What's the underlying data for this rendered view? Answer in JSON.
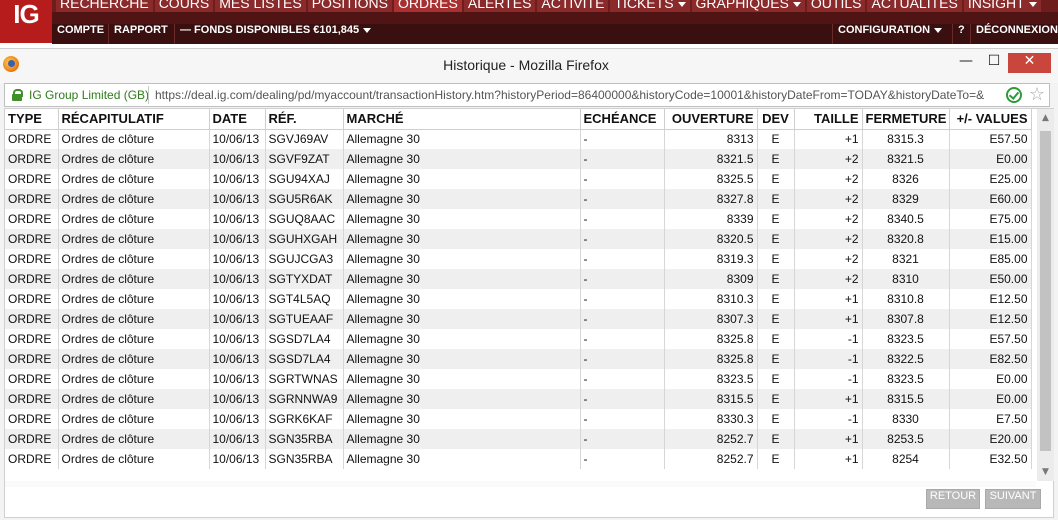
{
  "ig": {
    "logo": "IG",
    "nav": [
      {
        "label": "RECHERCHE",
        "caret": false
      },
      {
        "label": "COURS",
        "caret": false
      },
      {
        "label": "MES LISTES",
        "caret": false
      },
      {
        "label": "POSITIONS",
        "caret": false
      },
      {
        "label": "ORDRES",
        "caret": false,
        "active": true
      },
      {
        "label": "ALERTES",
        "caret": false
      },
      {
        "label": "ACTIVITÉ",
        "caret": false
      },
      {
        "label": "TICKETS",
        "caret": true
      },
      {
        "label": "GRAPHIQUES",
        "caret": true
      },
      {
        "label": "OUTILS",
        "caret": false
      },
      {
        "label": "ACTUALITÉS",
        "caret": false
      },
      {
        "label": "INSIGHT",
        "caret": true
      }
    ],
    "subnav": {
      "compte": "COMPTE",
      "rapport": "RAPPORT",
      "fonds": "— FONDS DISPONIBLES €101,845",
      "configuration": "CONFIGURATION",
      "help": "?",
      "deconnexion": "DÉCONNEXION"
    }
  },
  "window": {
    "title": "Historique - Mozilla Firefox",
    "minimize": "—",
    "maximize": "☐",
    "close": "✕"
  },
  "urlbar": {
    "site_identity": "IG Group Limited (GB)",
    "url": "https://deal.ig.com/dealing/pd/myaccount/transactionHistory.htm?historyPeriod=86400000&historyCode=10001&historyDateFrom=TODAY&historyDateTo=&"
  },
  "table": {
    "columns": [
      {
        "key": "type",
        "label": "TYPE",
        "align": "left"
      },
      {
        "key": "recap",
        "label": "RÉCAPITULATIF",
        "align": "left"
      },
      {
        "key": "date",
        "label": "DATE",
        "align": "left"
      },
      {
        "key": "ref",
        "label": "RÉF.",
        "align": "left"
      },
      {
        "key": "marche",
        "label": "MARCHÉ",
        "align": "left"
      },
      {
        "key": "echeance",
        "label": "ECHÉANCE",
        "align": "left"
      },
      {
        "key": "ouverture",
        "label": "OUVERTURE",
        "align": "right"
      },
      {
        "key": "dev",
        "label": "DEV",
        "align": "center"
      },
      {
        "key": "taille",
        "label": "TAILLE",
        "align": "right"
      },
      {
        "key": "fermeture",
        "label": "FERMETURE",
        "align": "center"
      },
      {
        "key": "values",
        "label": "+/- VALUES",
        "align": "right"
      }
    ],
    "rows": [
      {
        "type": "ORDRE",
        "recap": "Ordres de clôture",
        "date": "10/06/13",
        "ref": "SGVJ69AV",
        "marche": "Allemagne 30",
        "echeance": "-",
        "ouverture": "8313",
        "dev": "E",
        "taille": "+1",
        "fermeture": "8315.3",
        "values": "E57.50"
      },
      {
        "type": "ORDRE",
        "recap": "Ordres de clôture",
        "date": "10/06/13",
        "ref": "SGVF9ZAT",
        "marche": "Allemagne 30",
        "echeance": "-",
        "ouverture": "8321.5",
        "dev": "E",
        "taille": "+2",
        "fermeture": "8321.5",
        "values": "E0.00"
      },
      {
        "type": "ORDRE",
        "recap": "Ordres de clôture",
        "date": "10/06/13",
        "ref": "SGU94XAJ",
        "marche": "Allemagne 30",
        "echeance": "-",
        "ouverture": "8325.5",
        "dev": "E",
        "taille": "+2",
        "fermeture": "8326",
        "values": "E25.00"
      },
      {
        "type": "ORDRE",
        "recap": "Ordres de clôture",
        "date": "10/06/13",
        "ref": "SGU5R6AK",
        "marche": "Allemagne 30",
        "echeance": "-",
        "ouverture": "8327.8",
        "dev": "E",
        "taille": "+2",
        "fermeture": "8329",
        "values": "E60.00"
      },
      {
        "type": "ORDRE",
        "recap": "Ordres de clôture",
        "date": "10/06/13",
        "ref": "SGUQ8AAC",
        "marche": "Allemagne 30",
        "echeance": "-",
        "ouverture": "8339",
        "dev": "E",
        "taille": "+2",
        "fermeture": "8340.5",
        "values": "E75.00"
      },
      {
        "type": "ORDRE",
        "recap": "Ordres de clôture",
        "date": "10/06/13",
        "ref": "SGUHXGAH",
        "marche": "Allemagne 30",
        "echeance": "-",
        "ouverture": "8320.5",
        "dev": "E",
        "taille": "+2",
        "fermeture": "8320.8",
        "values": "E15.00"
      },
      {
        "type": "ORDRE",
        "recap": "Ordres de clôture",
        "date": "10/06/13",
        "ref": "SGUJCGA3",
        "marche": "Allemagne 30",
        "echeance": "-",
        "ouverture": "8319.3",
        "dev": "E",
        "taille": "+2",
        "fermeture": "8321",
        "values": "E85.00"
      },
      {
        "type": "ORDRE",
        "recap": "Ordres de clôture",
        "date": "10/06/13",
        "ref": "SGTYXDAT",
        "marche": "Allemagne 30",
        "echeance": "-",
        "ouverture": "8309",
        "dev": "E",
        "taille": "+2",
        "fermeture": "8310",
        "values": "E50.00"
      },
      {
        "type": "ORDRE",
        "recap": "Ordres de clôture",
        "date": "10/06/13",
        "ref": "SGT4L5AQ",
        "marche": "Allemagne 30",
        "echeance": "-",
        "ouverture": "8310.3",
        "dev": "E",
        "taille": "+1",
        "fermeture": "8310.8",
        "values": "E12.50"
      },
      {
        "type": "ORDRE",
        "recap": "Ordres de clôture",
        "date": "10/06/13",
        "ref": "SGTUEAAF",
        "marche": "Allemagne 30",
        "echeance": "-",
        "ouverture": "8307.3",
        "dev": "E",
        "taille": "+1",
        "fermeture": "8307.8",
        "values": "E12.50"
      },
      {
        "type": "ORDRE",
        "recap": "Ordres de clôture",
        "date": "10/06/13",
        "ref": "SGSD7LA4",
        "marche": "Allemagne 30",
        "echeance": "-",
        "ouverture": "8325.8",
        "dev": "E",
        "taille": "-1",
        "fermeture": "8323.5",
        "values": "E57.50"
      },
      {
        "type": "ORDRE",
        "recap": "Ordres de clôture",
        "date": "10/06/13",
        "ref": "SGSD7LA4",
        "marche": "Allemagne 30",
        "echeance": "-",
        "ouverture": "8325.8",
        "dev": "E",
        "taille": "-1",
        "fermeture": "8322.5",
        "values": "E82.50"
      },
      {
        "type": "ORDRE",
        "recap": "Ordres de clôture",
        "date": "10/06/13",
        "ref": "SGRTWNAS",
        "marche": "Allemagne 30",
        "echeance": "-",
        "ouverture": "8323.5",
        "dev": "E",
        "taille": "-1",
        "fermeture": "8323.5",
        "values": "E0.00"
      },
      {
        "type": "ORDRE",
        "recap": "Ordres de clôture",
        "date": "10/06/13",
        "ref": "SGRNNWA9",
        "marche": "Allemagne 30",
        "echeance": "-",
        "ouverture": "8315.5",
        "dev": "E",
        "taille": "+1",
        "fermeture": "8315.5",
        "values": "E0.00"
      },
      {
        "type": "ORDRE",
        "recap": "Ordres de clôture",
        "date": "10/06/13",
        "ref": "SGRK6KAF",
        "marche": "Allemagne 30",
        "echeance": "-",
        "ouverture": "8330.3",
        "dev": "E",
        "taille": "-1",
        "fermeture": "8330",
        "values": "E7.50"
      },
      {
        "type": "ORDRE",
        "recap": "Ordres de clôture",
        "date": "10/06/13",
        "ref": "SGN35RBA",
        "marche": "Allemagne 30",
        "echeance": "-",
        "ouverture": "8252.7",
        "dev": "E",
        "taille": "+1",
        "fermeture": "8253.5",
        "values": "E20.00"
      },
      {
        "type": "ORDRE",
        "recap": "Ordres de clôture",
        "date": "10/06/13",
        "ref": "SGN35RBA",
        "marche": "Allemagne 30",
        "echeance": "-",
        "ouverture": "8252.7",
        "dev": "E",
        "taille": "+1",
        "fermeture": "8254",
        "values": "E32.50"
      }
    ]
  },
  "pager": {
    "retour": "RETOUR",
    "suivant": "SUIVANT"
  },
  "colors": {
    "ig_red": "#b71c1c",
    "nav_bg": "#6e1c1c",
    "row_alt": "#efefef",
    "secure_green": "#2e7d1b"
  }
}
